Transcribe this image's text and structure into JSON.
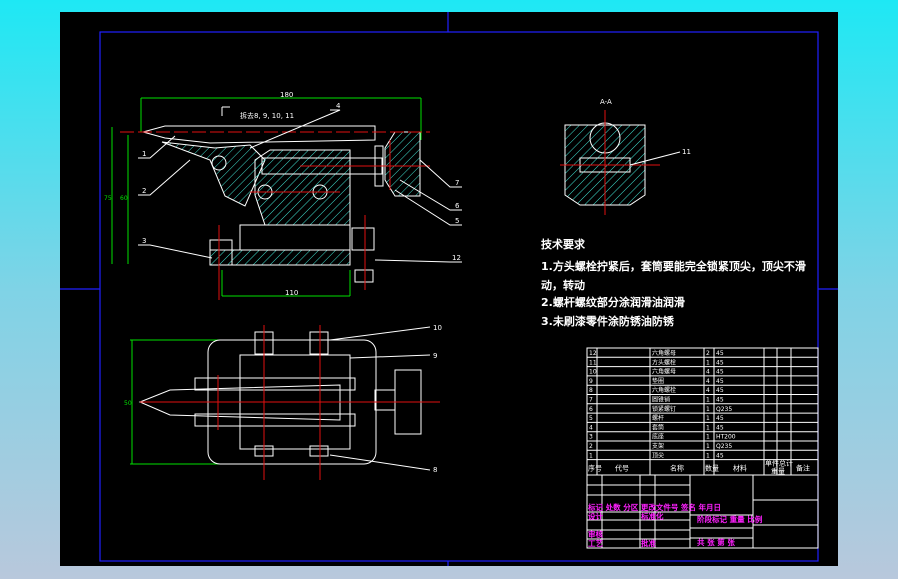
{
  "colors": {
    "background": "#000000",
    "outline": "#ffffff",
    "centerline": "#e01010",
    "dimension": "#00e000",
    "frame": "#2020ff",
    "hatch": "#40e0d0",
    "title_block_text": "#ff20ff"
  },
  "drawing": {
    "section_note": "拆去8, 9, 10, 11",
    "section_label": "A-A",
    "dims": {
      "top_length": "180",
      "left_height": "75",
      "left_inner": "60",
      "bottom_length": "110",
      "plan_height": "50"
    },
    "leaders": [
      "1",
      "2",
      "3",
      "4",
      "5",
      "6",
      "7",
      "12",
      "10",
      "9",
      "8",
      "11"
    ]
  },
  "tech": {
    "title": "技术要求",
    "lines": [
      "1.方头螺栓拧紧后，套筒要能完全锁紧顶尖，顶尖不滑",
      "动，转动",
      "2.螺杆螺纹部分涂润滑油润滑",
      "3.未刷漆零件涂防锈油防锈"
    ]
  },
  "parts": {
    "rows": [
      [
        "12",
        "",
        "六角螺母",
        "2",
        "45"
      ],
      [
        "11",
        "",
        "方头螺栓",
        "1",
        "45"
      ],
      [
        "10",
        "",
        "六角螺母",
        "4",
        "45"
      ],
      [
        "9",
        "",
        "垫圈",
        "4",
        "45"
      ],
      [
        "8",
        "",
        "六角螺栓",
        "4",
        "45"
      ],
      [
        "7",
        "",
        "圆锥销",
        "1",
        "45"
      ],
      [
        "6",
        "",
        "锁紧螺钉",
        "1",
        "Q235"
      ],
      [
        "5",
        "",
        "螺杆",
        "1",
        "45"
      ],
      [
        "4",
        "",
        "套筒",
        "1",
        "45"
      ],
      [
        "3",
        "",
        "底座",
        "1",
        "HT200"
      ],
      [
        "2",
        "",
        "支架",
        "1",
        "Q235"
      ],
      [
        "1",
        "",
        "顶尖",
        "1",
        "45"
      ]
    ],
    "header": {
      "no": "序号",
      "code": "代号",
      "name": "名称",
      "qty": "数量",
      "material": "材料",
      "unit": "单件",
      "total": "总计",
      "weight": "重量",
      "note": "备注"
    }
  },
  "title_block": {
    "revision": "标记 处数 分区 更改文件号 签名 年月日",
    "design": "设计",
    "standard": "标准化",
    "review": "审核",
    "process": "工艺",
    "approve": "批准",
    "stage": "阶段标记 重量 比例",
    "sheets": "共  张  第  张"
  }
}
